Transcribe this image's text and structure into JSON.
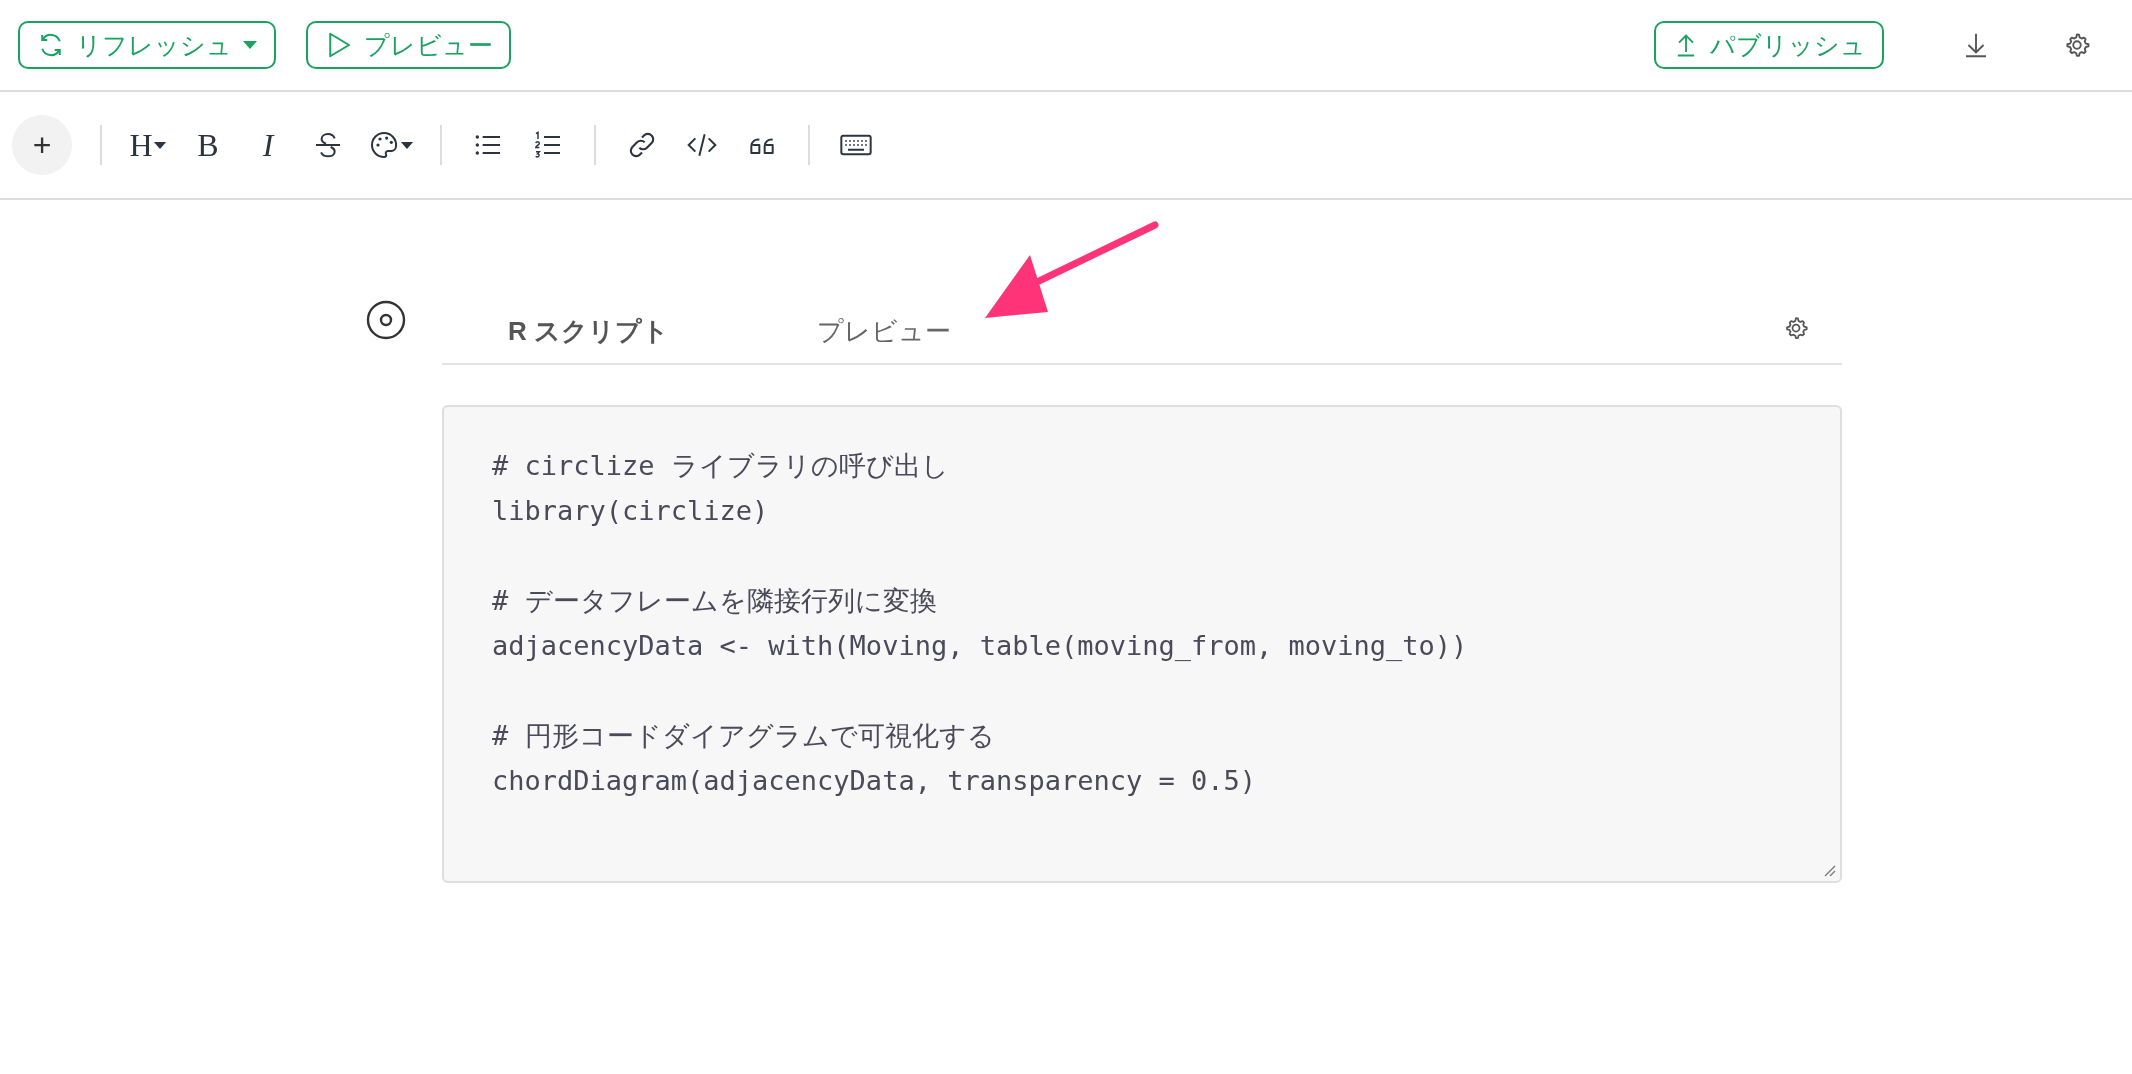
{
  "header": {
    "buttons": [
      {
        "kind": "refresh",
        "label": "リフレッシュ",
        "dropdown": true
      },
      {
        "kind": "preview",
        "label": "プレビュー",
        "dropdown": false
      }
    ],
    "publish": {
      "label": "パブリッシュ"
    }
  },
  "toolbar": {
    "add": {
      "label": "+"
    },
    "groups": [
      [
        {
          "kind": "heading",
          "label": "H",
          "dropdown": true
        },
        {
          "kind": "bold",
          "label": "B"
        },
        {
          "kind": "italic",
          "label": "I"
        },
        {
          "kind": "strike"
        },
        {
          "kind": "palette",
          "dropdown": true
        }
      ],
      [
        {
          "kind": "bullets"
        },
        {
          "kind": "numbered"
        }
      ],
      [
        {
          "kind": "link"
        },
        {
          "kind": "code"
        },
        {
          "kind": "quote"
        }
      ],
      [
        {
          "kind": "keyboard"
        }
      ]
    ]
  },
  "editor": {
    "tabs": [
      {
        "label": "R スクリプト",
        "selected": true
      },
      {
        "label": "プレビュー",
        "selected": false
      }
    ],
    "code_blocks": [
      [
        "# circlize ライブラリの呼び出し",
        "library(circlize)"
      ],
      [
        "# データフレームを隣接行列に変換",
        "adjacencyData <- with(Moving, table(moving_from, moving_to))"
      ],
      [
        "# 円形コードダイアグラムで可視化する",
        "chordDiagram(adjacencyData, transparency = 0.5)"
      ]
    ]
  }
}
